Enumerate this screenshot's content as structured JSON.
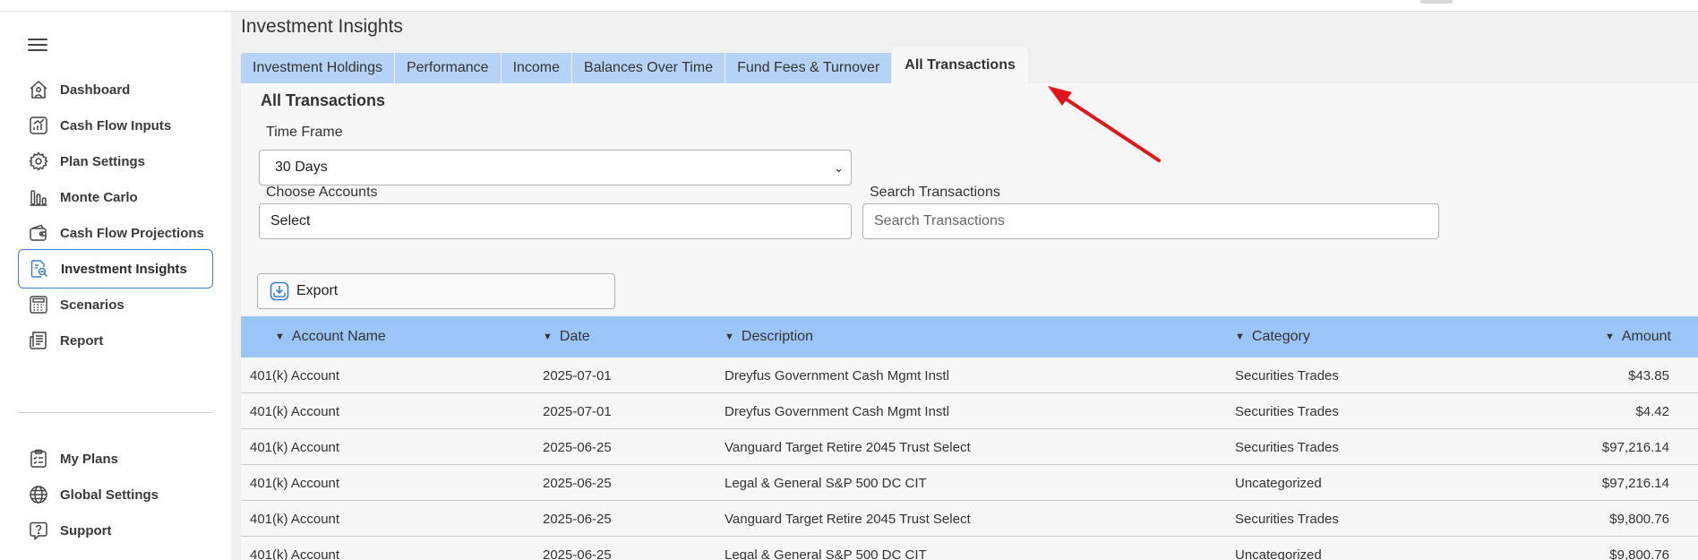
{
  "sidebar": {
    "items": [
      {
        "label": "Dashboard",
        "icon": "house-icon"
      },
      {
        "label": "Cash Flow Inputs",
        "icon": "chart-trend-icon"
      },
      {
        "label": "Plan Settings",
        "icon": "gear-icon"
      },
      {
        "label": "Monte Carlo",
        "icon": "bar-chart-icon"
      },
      {
        "label": "Cash Flow Projections",
        "icon": "wallet-icon"
      },
      {
        "label": "Investment Insights",
        "icon": "document-search-icon"
      },
      {
        "label": "Scenarios",
        "icon": "calculator-icon"
      },
      {
        "label": "Report",
        "icon": "newspaper-icon"
      },
      {
        "label": "My Plans",
        "icon": "clipboard-icon"
      },
      {
        "label": "Global Settings",
        "icon": "globe-icon"
      },
      {
        "label": "Support",
        "icon": "help-bubble-icon"
      }
    ],
    "active": "Investment Insights"
  },
  "page": {
    "title": "Investment Insights"
  },
  "tabs": [
    {
      "label": "Investment Holdings"
    },
    {
      "label": "Performance"
    },
    {
      "label": "Income"
    },
    {
      "label": "Balances Over Time"
    },
    {
      "label": "Fund Fees & Turnover"
    },
    {
      "label": "All Transactions"
    }
  ],
  "active_tab": "All Transactions",
  "transactions": {
    "title": "All Transactions",
    "time_frame": {
      "label": "Time Frame",
      "value": "30 Days"
    },
    "accounts": {
      "label": "Choose Accounts",
      "value": "Select"
    },
    "search": {
      "label": "Search Transactions",
      "placeholder": "Search Transactions"
    },
    "export_label": "Export"
  },
  "table": {
    "columns": [
      "Account Name",
      "Date",
      "Description",
      "Category",
      "Amount"
    ],
    "rows": [
      [
        "401(k) Account",
        "2025-07-01",
        "Dreyfus Government Cash Mgmt Instl",
        "Securities Trades",
        "$43.85"
      ],
      [
        "401(k) Account",
        "2025-07-01",
        "Dreyfus Government Cash Mgmt Instl",
        "Securities Trades",
        "$4.42"
      ],
      [
        "401(k) Account",
        "2025-06-25",
        "Vanguard Target Retire 2045 Trust Select",
        "Securities Trades",
        "$97,216.14"
      ],
      [
        "401(k) Account",
        "2025-06-25",
        "Legal & General S&P 500 DC CIT",
        "Uncategorized",
        "$97,216.14"
      ],
      [
        "401(k) Account",
        "2025-06-25",
        "Vanguard Target Retire 2045 Trust Select",
        "Securities Trades",
        "$9,800.76"
      ],
      [
        "401(k) Account",
        "2025-06-25",
        "Legal & General S&P 500 DC CIT",
        "Uncategorized",
        "$9,800.76"
      ]
    ]
  },
  "colors": {
    "tab_bg": "#b6d3f5",
    "table_header_bg": "#9cc5f7",
    "active_border": "#3c7fd0",
    "annotation_arrow": "#e0161b"
  }
}
